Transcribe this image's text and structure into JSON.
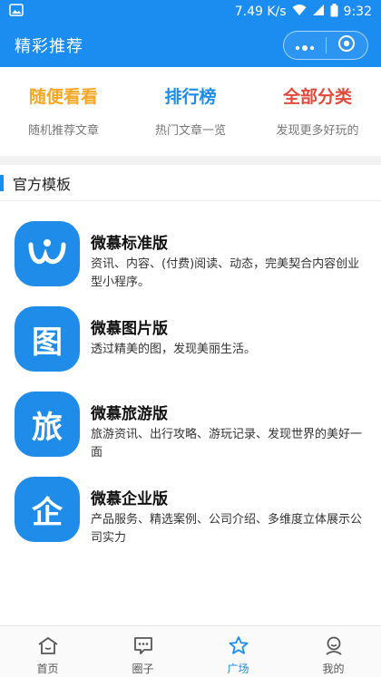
{
  "status_bar": {
    "speed": "7.49 K/s",
    "time": "9:32"
  },
  "nav": {
    "title": "精彩推荐"
  },
  "quick_links": [
    {
      "title": "随便看看",
      "subtitle": "随机推荐文章",
      "color": "#f5a623"
    },
    {
      "title": "排行榜",
      "subtitle": "热门文章一览",
      "color": "#1b8cf0"
    },
    {
      "title": "全部分类",
      "subtitle": "发现更多好玩的",
      "color": "#e24b3b"
    }
  ],
  "section": {
    "title": "官方模板"
  },
  "templates": [
    {
      "icon": "wei-logo-icon",
      "title": "微慕标准版",
      "description": "资讯、内容、(付费)阅读、动态，完美契合内容创业型小程序。"
    },
    {
      "icon_char": "图",
      "title": "微慕图片版",
      "description": "透过精美的图，发现美丽生活。"
    },
    {
      "icon_char": "旅",
      "title": "微慕旅游版",
      "description": "旅游资讯、出行攻略、游玩记录、发现世界的美好一面"
    },
    {
      "icon_char": "企",
      "title": "微慕企业版",
      "description": "产品服务、精选案例、公司介绍、多维度立体展示公司实力"
    }
  ],
  "tabs": [
    {
      "label": "首页",
      "icon": "home-icon"
    },
    {
      "label": "圈子",
      "icon": "chat-icon"
    },
    {
      "label": "广场",
      "icon": "star-icon",
      "active": true
    },
    {
      "label": "我的",
      "icon": "user-icon"
    }
  ],
  "colors": {
    "primary": "#1b8cf0",
    "icon_bg": "#1f8cea"
  }
}
